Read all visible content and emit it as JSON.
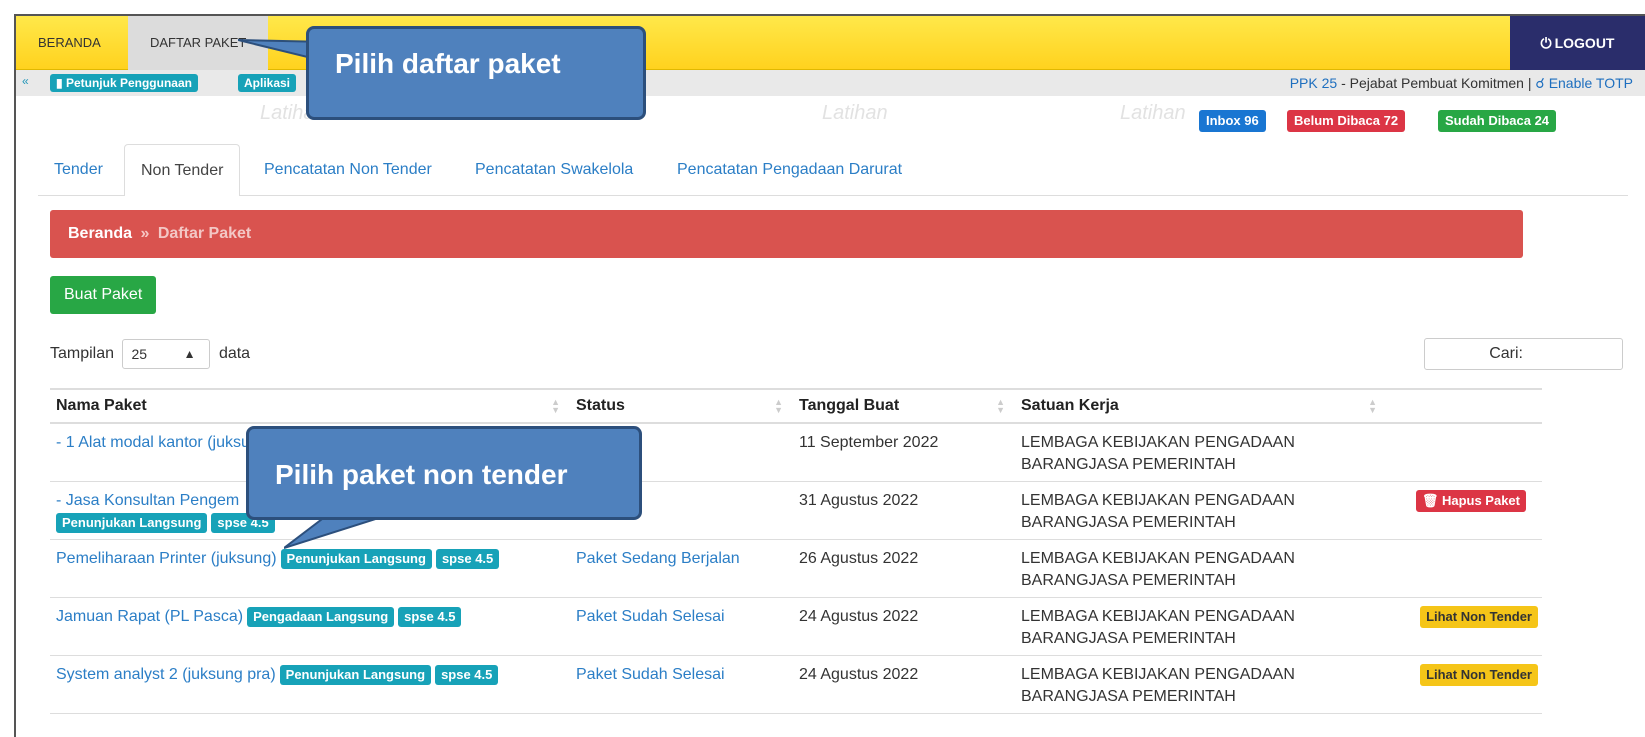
{
  "topnav": {
    "items": [
      {
        "label": "BERANDA"
      },
      {
        "label": "DAFTAR PAKET"
      }
    ],
    "logout": "LOGOUT"
  },
  "secondary": {
    "petunjuk": "Petunjuk Penggunaan",
    "aplikasi": "Aplikasi",
    "user_role_link": "PPK 25",
    "user_role_text": " - Pejabat Pembuat Komitmen | ",
    "enable_totp": "Enable TOTP"
  },
  "badges": {
    "inbox": "Inbox 96",
    "belum": "Belum Dibaca 72",
    "sudah": "Sudah Dibaca 24"
  },
  "tabs": [
    {
      "label": "Tender"
    },
    {
      "label": "Non Tender"
    },
    {
      "label": "Pencatatan Non Tender"
    },
    {
      "label": "Pencatatan Swakelola"
    },
    {
      "label": "Pencatatan Pengadaan Darurat"
    }
  ],
  "breadcrumb": {
    "home": "Beranda",
    "sep": "»",
    "current": "Daftar Paket"
  },
  "buat_paket": "Buat Paket",
  "length": {
    "prefix": "Tampilan",
    "value": "25",
    "suffix": "data"
  },
  "search": {
    "label": "Cari:"
  },
  "table": {
    "headers": [
      "Nama Paket",
      "Status",
      "Tanggal Buat",
      "Satuan Kerja"
    ],
    "rows": [
      {
        "name": "- 1 Alat modal kantor (juksu",
        "labels": [],
        "status": "",
        "date": "11 September 2022",
        "satker1": "LEMBAGA KEBIJAKAN PENGADAAN",
        "satker2": "BARANGJASA PEMERINTAH",
        "action": ""
      },
      {
        "name": "- Jasa Konsultan Pengem",
        "labels": [
          "Penunjukan Langsung",
          "spse 4.5"
        ],
        "status": "",
        "date": "31 Agustus 2022",
        "satker1": "LEMBAGA KEBIJAKAN PENGADAAN",
        "satker2": "BARANGJASA PEMERINTAH",
        "action": "Hapus Paket"
      },
      {
        "name": "Pemeliharaan Printer (juksung)",
        "labels": [
          "Penunjukan Langsung",
          "spse 4.5"
        ],
        "status": "Paket Sedang Berjalan",
        "date": "26 Agustus 2022",
        "satker1": "LEMBAGA KEBIJAKAN PENGADAAN",
        "satker2": "BARANGJASA PEMERINTAH",
        "action": ""
      },
      {
        "name": "Jamuan Rapat (PL Pasca)",
        "labels": [
          "Pengadaan Langsung",
          "spse 4.5"
        ],
        "status": "Paket Sudah Selesai",
        "date": "24 Agustus 2022",
        "satker1": "LEMBAGA KEBIJAKAN PENGADAAN",
        "satker2": "BARANGJASA PEMERINTAH",
        "action": "Lihat Non Tender"
      },
      {
        "name": "System analyst 2 (juksung pra)",
        "labels": [
          "Penunjukan Langsung",
          "spse 4.5"
        ],
        "status": "Paket Sudah Selesai",
        "date": "24 Agustus 2022",
        "satker1": "LEMBAGA KEBIJAKAN PENGADAAN",
        "satker2": "BARANGJASA PEMERINTAH",
        "action": "Lihat Non Tender"
      }
    ]
  },
  "callouts": {
    "c1": "Pilih daftar paket",
    "c2": "Pilih paket non tender"
  },
  "watermark": "Latihan",
  "colors": {
    "topbar": "#ffd21e",
    "logout": "#2a2d6b",
    "breadcrumb": "#d9534f",
    "callout": "#4f81bd",
    "label": "#17a2b8"
  }
}
